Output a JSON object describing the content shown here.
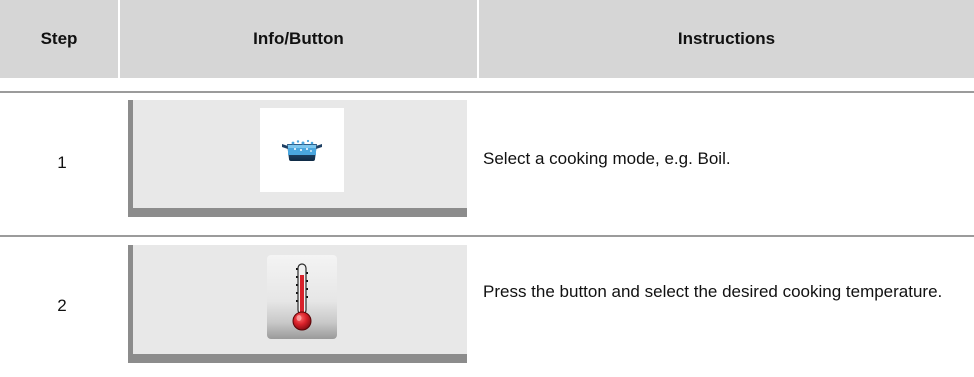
{
  "header": {
    "step": "Step",
    "info_button": "Info/Button",
    "instructions": "Instructions"
  },
  "rows": [
    {
      "step": "1",
      "icon": "boil-pot-icon",
      "instruction": "Select a cooking mode, e.g. Boil."
    },
    {
      "step": "2",
      "icon": "thermometer-icon",
      "instruction": "Press the button and select the desired cooking temperature."
    }
  ],
  "colors": {
    "header_bg": "#d6d6d6",
    "panel_bg": "#e8e8e8",
    "panel_edge": "#8c8c8c",
    "rule": "#9b9b9b",
    "pot_blue": "#3a8fc6",
    "thermo_red": "#d8212a"
  }
}
